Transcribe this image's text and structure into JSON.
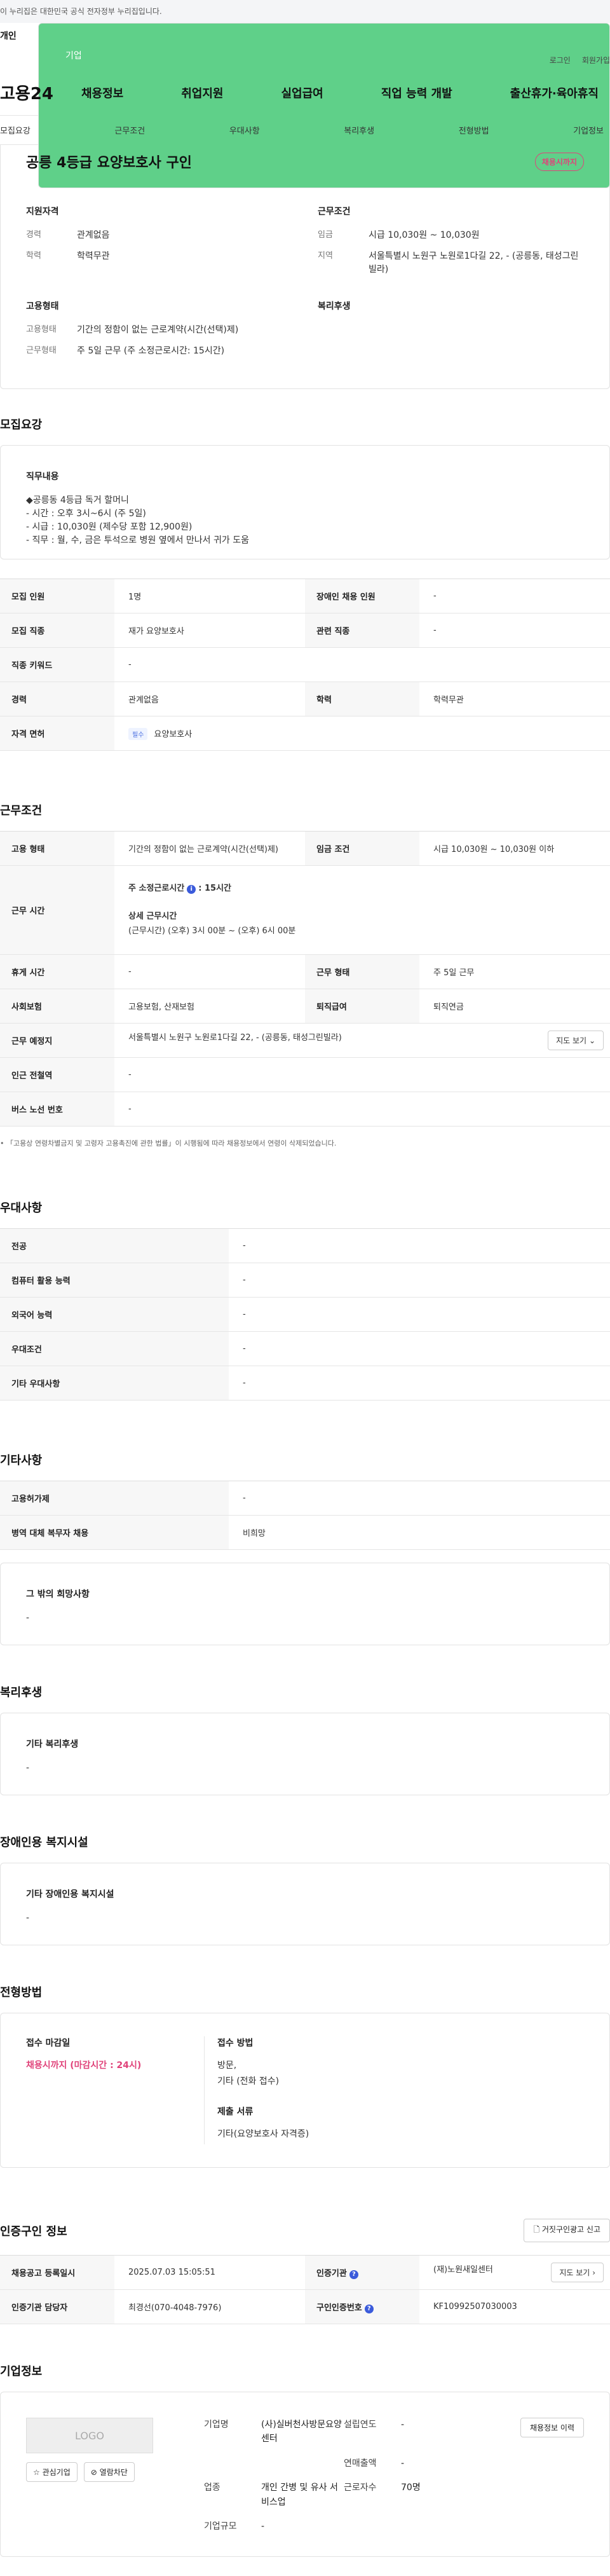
{
  "banner": "이 누리집은 대한민국 공식 전자정부 누리집입니다.",
  "tabs": {
    "personal": "개인",
    "company": "기업"
  },
  "util": {
    "login": "로그인",
    "join": "회원가입"
  },
  "logo": "고용24",
  "gnb": [
    "채용정보",
    "취업지원",
    "실업급여",
    "직업 능력 개발",
    "출산휴가·육아휴직"
  ],
  "anchors": [
    "모집요강",
    "근무조건",
    "우대사항",
    "복리후생",
    "전형방법",
    "기업정보"
  ],
  "job": {
    "title": "공릉 4등급 요양보호사 구인",
    "deadline_badge": "채용시까지",
    "qual_title": "지원자격",
    "qual": [
      {
        "k": "경력",
        "v": "관계없음"
      },
      {
        "k": "학력",
        "v": "학력무관"
      }
    ],
    "cond_title": "근무조건",
    "cond": [
      {
        "k": "임금",
        "v": "시급 10,030원 ~ 10,030원"
      },
      {
        "k": "지역",
        "v": "서울특별시 노원구 노원로1다길 22, - (공릉동, 태성그린빌라)"
      }
    ],
    "emp_title": "고용형태",
    "emp": [
      {
        "k": "고용형태",
        "v": "기간의 정함이 없는 근로계약(시간(선택)제)"
      },
      {
        "k": "근무형태",
        "v": "주 5일 근무 (주 소정근로시간: 15시간)"
      }
    ],
    "welfare_title": "복리후생"
  },
  "recruit": {
    "title": "모집요강",
    "duty_label": "직무내용",
    "duty_text": "◆공릉동 4등급 독거 할머니\n- 시간 : 오후 3시~6시 (주 5일)\n- 시급 : 10,030원 (제수당 포함 12,900원)\n- 직무 : 월, 수, 금은 투석으로 병원 옆에서 만나서 귀가 도움",
    "rows": {
      "count_k": "모집 인원",
      "count_v": "1명",
      "disabled_k": "장애인 채용 인원",
      "disabled_v": "-",
      "job_k": "모집 직종",
      "job_v": "재가 요양보호사",
      "related_k": "관련 직종",
      "related_v": "-",
      "keyword_k": "직종 키워드",
      "keyword_v": "-",
      "career_k": "경력",
      "career_v": "관계없음",
      "edu_k": "학력",
      "edu_v": "학력무관",
      "license_k": "자격 면허",
      "license_tag": "필수",
      "license_v": "요양보호사"
    }
  },
  "work": {
    "title": "근무조건",
    "type_k": "고용 형태",
    "type_v": "기간의 정함이 없는 근로계약(시간(선택)제)",
    "wage_k": "임금 조건",
    "wage_v": "시급 10,030원 ~ 10,030원 이하",
    "time_k": "근무 시간",
    "time_weekly": "주 소정근로시간",
    "time_weekly_v": ": 15시간",
    "time_detail_label": "상세 근무시간",
    "time_detail": "(근무시간) (오후) 3시 00분 ~ (오후) 6시 00분",
    "rest_k": "휴게 시간",
    "rest_v": "-",
    "form_k": "근무 형태",
    "form_v": "주 5일 근무",
    "insurance_k": "사회보험",
    "insurance_v": "고용보험, 산재보험",
    "retire_k": "퇴직급여",
    "retire_v": "퇴직연금",
    "place_k": "근무 예정지",
    "place_v": "서울특별시 노원구 노원로1다길 22, - (공릉동, 태성그린빌라)",
    "map_btn": "지도 보기",
    "subway_k": "인근 전철역",
    "subway_v": "-",
    "bus_k": "버스 노선 번호",
    "bus_v": "-",
    "note": "「고용상 연령차별금지 및 고령자 고용촉진에 관한 법률」이 시행됨에 따라 채용정보에서 연령이 삭제되었습니다."
  },
  "prefer": {
    "title": "우대사항",
    "rows": [
      {
        "k": "전공",
        "v": "-"
      },
      {
        "k": "컴퓨터 활용 능력",
        "v": "-"
      },
      {
        "k": "외국어 능력",
        "v": "-"
      },
      {
        "k": "우대조건",
        "v": "-"
      },
      {
        "k": "기타 우대사항",
        "v": "-"
      }
    ]
  },
  "etc": {
    "title": "기타사항",
    "rows": [
      {
        "k": "고용허가제",
        "v": "-"
      },
      {
        "k": "병역 대체 복무자 채용",
        "v": "비희망"
      }
    ],
    "other_label": "그 밖의 희망사항",
    "other_v": "-"
  },
  "welfare": {
    "title": "복리후생",
    "label": "기타 복리후생",
    "v": "-"
  },
  "facility": {
    "title": "장애인용 복지시설",
    "label": "기타 장애인용 복지시설",
    "v": "-"
  },
  "process": {
    "title": "전형방법",
    "deadline_label": "접수 마감일",
    "deadline_v": "채용시까지 (마감시간 : 24시)",
    "method_label": "접수 방법",
    "method_v": "방문,\n기타 (전화 접수)",
    "docs_label": "제출 서류",
    "docs_v": "기타(요양보호사 자격증)"
  },
  "cert": {
    "title": "인증구인 정보",
    "report_btn": "거짓구인광고 신고",
    "reg_k": "채용공고 등록일시",
    "reg_v": "2025.07.03 15:05:51",
    "org_k": "인증기관",
    "org_v": "(재)노원새일센터",
    "map_btn": "지도 보기",
    "manager_k": "인증기관 담당자",
    "manager_v": "최경선(070-4048-7976)",
    "num_k": "구인인증번호",
    "num_v": "KF10992507030003"
  },
  "company": {
    "title": "기업정보",
    "logo": "LOGO",
    "fav_btn": "관심기업",
    "block_btn": "열람차단",
    "name_k": "기업명",
    "name_v": "(사)실버천사방문요양센터",
    "year_k": "설립연도",
    "year_v": "-",
    "sales_k": "연매출액",
    "sales_v": "-",
    "industry_k": "업종",
    "industry_v": "개인 간병 및 유사 서비스업",
    "emp_k": "근로자수",
    "emp_v": "70명",
    "size_k": "기업규모",
    "size_v": "-",
    "history_btn": "채용정보 이력"
  }
}
